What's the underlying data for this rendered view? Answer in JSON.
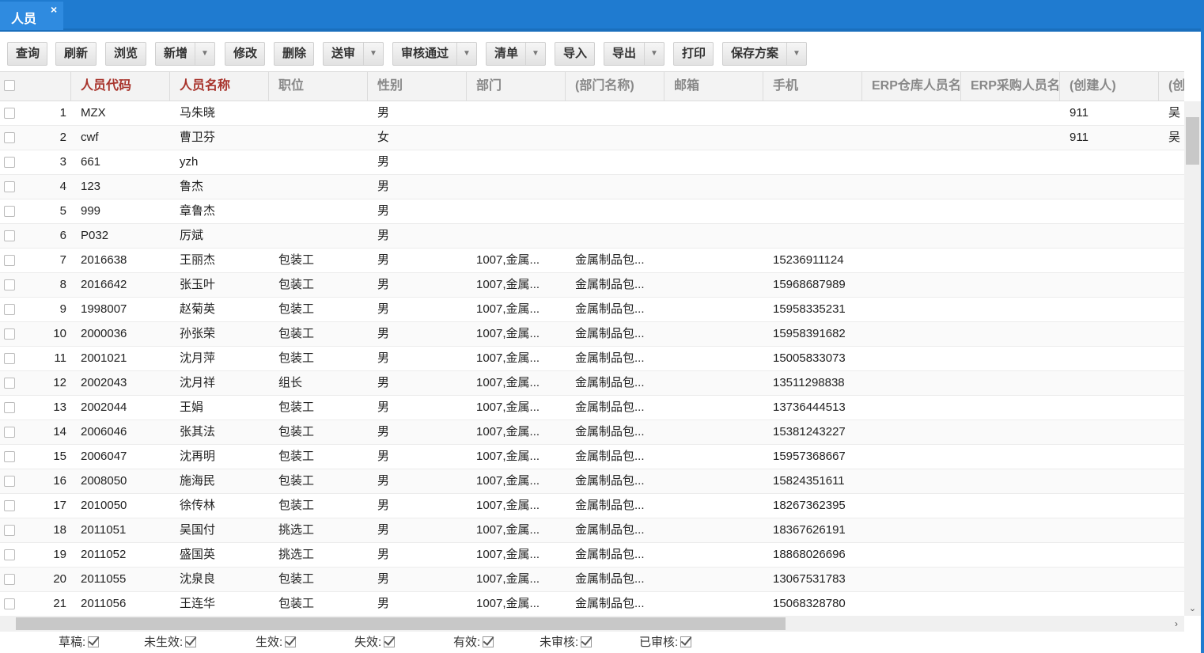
{
  "tab": {
    "title": "人员",
    "close": "×"
  },
  "toolbar": [
    {
      "id": "query",
      "label": "查询",
      "dropdown": false
    },
    {
      "id": "refresh",
      "label": "刷新",
      "dropdown": false
    },
    {
      "id": "browse",
      "label": "浏览",
      "dropdown": false
    },
    {
      "id": "add",
      "label": "新增",
      "dropdown": true
    },
    {
      "id": "edit",
      "label": "修改",
      "dropdown": false
    },
    {
      "id": "delete",
      "label": "删除",
      "dropdown": false
    },
    {
      "id": "submit",
      "label": "送审",
      "dropdown": true
    },
    {
      "id": "approve",
      "label": "审核通过",
      "dropdown": true
    },
    {
      "id": "list",
      "label": "清单",
      "dropdown": true
    },
    {
      "id": "import",
      "label": "导入",
      "dropdown": false
    },
    {
      "id": "export",
      "label": "导出",
      "dropdown": true
    },
    {
      "id": "print",
      "label": "打印",
      "dropdown": false
    },
    {
      "id": "save-plan",
      "label": "保存方案",
      "dropdown": true
    }
  ],
  "dropdown_glyph": "▼",
  "columns": [
    {
      "key": "code",
      "label": "人员代码",
      "required": true
    },
    {
      "key": "name",
      "label": "人员名称",
      "required": true
    },
    {
      "key": "position",
      "label": "职位",
      "required": false
    },
    {
      "key": "gender",
      "label": "性别",
      "required": false
    },
    {
      "key": "dept",
      "label": "部门",
      "required": false
    },
    {
      "key": "dept_name",
      "label": "(部门名称)",
      "required": false
    },
    {
      "key": "email",
      "label": "邮箱",
      "required": false
    },
    {
      "key": "mobile",
      "label": "手机",
      "required": false
    },
    {
      "key": "erp_wh",
      "label": "ERP仓库人员名",
      "required": false
    },
    {
      "key": "erp_pur",
      "label": "ERP采购人员名",
      "required": false
    },
    {
      "key": "creator",
      "label": "(创建人)",
      "required": false
    },
    {
      "key": "creator2",
      "label": "(创建",
      "required": false
    }
  ],
  "rows": [
    {
      "no": "1",
      "code": "MZX",
      "name": "马朱晓",
      "position": "",
      "gender": "男",
      "dept": "",
      "dept_name": "",
      "email": "",
      "mobile": "",
      "erp_wh": "",
      "erp_pur": "",
      "creator": "911",
      "creator2": "吴"
    },
    {
      "no": "2",
      "code": "cwf",
      "name": "曹卫芬",
      "position": "",
      "gender": "女",
      "dept": "",
      "dept_name": "",
      "email": "",
      "mobile": "",
      "erp_wh": "",
      "erp_pur": "",
      "creator": "911",
      "creator2": "吴"
    },
    {
      "no": "3",
      "code": "661",
      "name": "yzh",
      "position": "",
      "gender": "男",
      "dept": "",
      "dept_name": "",
      "email": "",
      "mobile": "",
      "erp_wh": "",
      "erp_pur": "",
      "creator": "",
      "creator2": ""
    },
    {
      "no": "4",
      "code": "123",
      "name": "鲁杰",
      "position": "",
      "gender": "男",
      "dept": "",
      "dept_name": "",
      "email": "",
      "mobile": "",
      "erp_wh": "",
      "erp_pur": "",
      "creator": "",
      "creator2": ""
    },
    {
      "no": "5",
      "code": "999",
      "name": "章鲁杰",
      "position": "",
      "gender": "男",
      "dept": "",
      "dept_name": "",
      "email": "",
      "mobile": "",
      "erp_wh": "",
      "erp_pur": "",
      "creator": "",
      "creator2": ""
    },
    {
      "no": "6",
      "code": "P032",
      "name": "厉斌",
      "position": "",
      "gender": "男",
      "dept": "",
      "dept_name": "",
      "email": "",
      "mobile": "",
      "erp_wh": "",
      "erp_pur": "",
      "creator": "",
      "creator2": ""
    },
    {
      "no": "7",
      "code": "2016638",
      "name": "王丽杰",
      "position": "包装工",
      "gender": "男",
      "dept": "1007,金属...",
      "dept_name": "金属制品包...",
      "email": "",
      "mobile": "15236911124",
      "erp_wh": "",
      "erp_pur": "",
      "creator": "",
      "creator2": ""
    },
    {
      "no": "8",
      "code": "2016642",
      "name": "张玉叶",
      "position": "包装工",
      "gender": "男",
      "dept": "1007,金属...",
      "dept_name": "金属制品包...",
      "email": "",
      "mobile": "15968687989",
      "erp_wh": "",
      "erp_pur": "",
      "creator": "",
      "creator2": ""
    },
    {
      "no": "9",
      "code": "1998007",
      "name": "赵菊英",
      "position": "包装工",
      "gender": "男",
      "dept": "1007,金属...",
      "dept_name": "金属制品包...",
      "email": "",
      "mobile": "15958335231",
      "erp_wh": "",
      "erp_pur": "",
      "creator": "",
      "creator2": ""
    },
    {
      "no": "10",
      "code": "2000036",
      "name": "孙张荣",
      "position": "包装工",
      "gender": "男",
      "dept": "1007,金属...",
      "dept_name": "金属制品包...",
      "email": "",
      "mobile": "15958391682",
      "erp_wh": "",
      "erp_pur": "",
      "creator": "",
      "creator2": ""
    },
    {
      "no": "11",
      "code": "2001021",
      "name": "沈月萍",
      "position": "包装工",
      "gender": "男",
      "dept": "1007,金属...",
      "dept_name": "金属制品包...",
      "email": "",
      "mobile": "15005833073",
      "erp_wh": "",
      "erp_pur": "",
      "creator": "",
      "creator2": ""
    },
    {
      "no": "12",
      "code": "2002043",
      "name": "沈月祥",
      "position": "组长",
      "gender": "男",
      "dept": "1007,金属...",
      "dept_name": "金属制品包...",
      "email": "",
      "mobile": "13511298838",
      "erp_wh": "",
      "erp_pur": "",
      "creator": "",
      "creator2": ""
    },
    {
      "no": "13",
      "code": "2002044",
      "name": "王娟",
      "position": "包装工",
      "gender": "男",
      "dept": "1007,金属...",
      "dept_name": "金属制品包...",
      "email": "",
      "mobile": "13736444513",
      "erp_wh": "",
      "erp_pur": "",
      "creator": "",
      "creator2": ""
    },
    {
      "no": "14",
      "code": "2006046",
      "name": "张其法",
      "position": "包装工",
      "gender": "男",
      "dept": "1007,金属...",
      "dept_name": "金属制品包...",
      "email": "",
      "mobile": "15381243227",
      "erp_wh": "",
      "erp_pur": "",
      "creator": "",
      "creator2": ""
    },
    {
      "no": "15",
      "code": "2006047",
      "name": "沈再明",
      "position": "包装工",
      "gender": "男",
      "dept": "1007,金属...",
      "dept_name": "金属制品包...",
      "email": "",
      "mobile": "15957368667",
      "erp_wh": "",
      "erp_pur": "",
      "creator": "",
      "creator2": ""
    },
    {
      "no": "16",
      "code": "2008050",
      "name": "施海民",
      "position": "包装工",
      "gender": "男",
      "dept": "1007,金属...",
      "dept_name": "金属制品包...",
      "email": "",
      "mobile": "15824351611",
      "erp_wh": "",
      "erp_pur": "",
      "creator": "",
      "creator2": ""
    },
    {
      "no": "17",
      "code": "2010050",
      "name": "徐传林",
      "position": "包装工",
      "gender": "男",
      "dept": "1007,金属...",
      "dept_name": "金属制品包...",
      "email": "",
      "mobile": "18267362395",
      "erp_wh": "",
      "erp_pur": "",
      "creator": "",
      "creator2": ""
    },
    {
      "no": "18",
      "code": "2011051",
      "name": "吴国付",
      "position": "挑选工",
      "gender": "男",
      "dept": "1007,金属...",
      "dept_name": "金属制品包...",
      "email": "",
      "mobile": "18367626191",
      "erp_wh": "",
      "erp_pur": "",
      "creator": "",
      "creator2": ""
    },
    {
      "no": "19",
      "code": "2011052",
      "name": "盛国英",
      "position": "挑选工",
      "gender": "男",
      "dept": "1007,金属...",
      "dept_name": "金属制品包...",
      "email": "",
      "mobile": "18868026696",
      "erp_wh": "",
      "erp_pur": "",
      "creator": "",
      "creator2": ""
    },
    {
      "no": "20",
      "code": "2011055",
      "name": "沈泉良",
      "position": "包装工",
      "gender": "男",
      "dept": "1007,金属...",
      "dept_name": "金属制品包...",
      "email": "",
      "mobile": "13067531783",
      "erp_wh": "",
      "erp_pur": "",
      "creator": "",
      "creator2": ""
    },
    {
      "no": "21",
      "code": "2011056",
      "name": "王连华",
      "position": "包装工",
      "gender": "男",
      "dept": "1007,金属...",
      "dept_name": "金属制品包...",
      "email": "",
      "mobile": "15068328780",
      "erp_wh": "",
      "erp_pur": "",
      "creator": "",
      "creator2": ""
    }
  ],
  "scroll": {
    "up": "⌃",
    "down": "⌄",
    "right": "›"
  },
  "filters": [
    {
      "id": "draft",
      "label": "草稿:",
      "checked": true
    },
    {
      "id": "not-effective",
      "label": "未生效:",
      "checked": true
    },
    {
      "id": "effective",
      "label": "生效:",
      "checked": true
    },
    {
      "id": "invalid",
      "label": "失效:",
      "checked": true
    },
    {
      "id": "valid",
      "label": "有效:",
      "checked": true
    },
    {
      "id": "unreviewed",
      "label": "未审核:",
      "checked": true
    },
    {
      "id": "reviewed",
      "label": "已审核:",
      "checked": true
    }
  ]
}
